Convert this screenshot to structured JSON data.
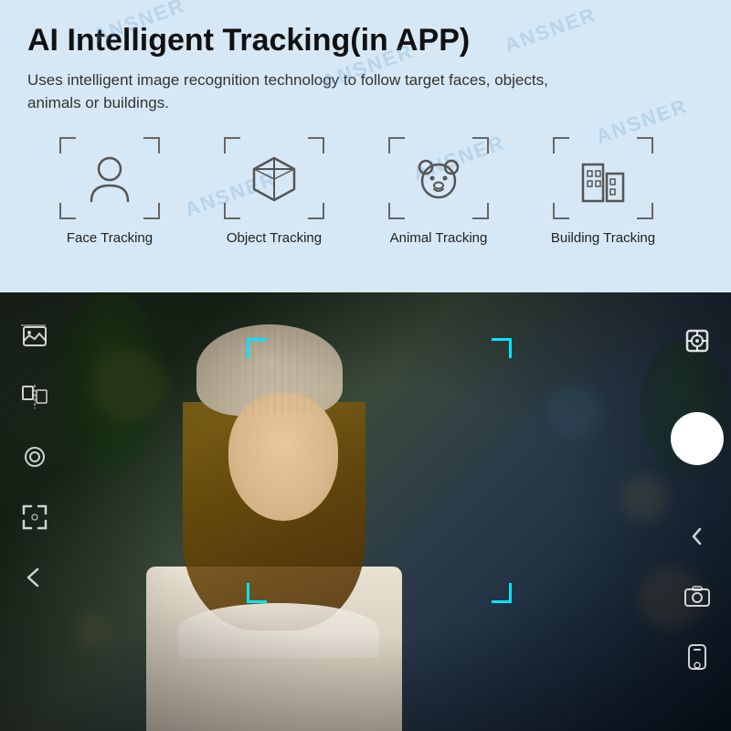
{
  "top": {
    "title": "AI Intelligent Tracking(in APP)",
    "subtitle": "Uses intelligent image recognition technology to follow target faces, objects, animals or buildings.",
    "watermark_text": "ANSNER",
    "tracking_items": [
      {
        "id": "face",
        "label": "Face Tracking",
        "icon": "face"
      },
      {
        "id": "object",
        "label": "Object Tracking",
        "icon": "object"
      },
      {
        "id": "animal",
        "label": "Animal Tracking",
        "icon": "animal"
      },
      {
        "id": "building",
        "label": "Building Tracking",
        "icon": "building"
      }
    ]
  },
  "bottom": {
    "left_icons": [
      {
        "id": "gallery",
        "label": "gallery-icon"
      },
      {
        "id": "flip",
        "label": "flip-icon"
      },
      {
        "id": "settings",
        "label": "settings-icon"
      },
      {
        "id": "focus",
        "label": "focus-icon"
      },
      {
        "id": "back",
        "label": "back-icon"
      }
    ],
    "right_icons": [
      {
        "id": "tracking",
        "label": "tracking-icon"
      },
      {
        "id": "shutter",
        "label": "shutter-button"
      },
      {
        "id": "camera-switch",
        "label": "camera-switch-icon"
      },
      {
        "id": "phone",
        "label": "phone-icon"
      }
    ]
  }
}
